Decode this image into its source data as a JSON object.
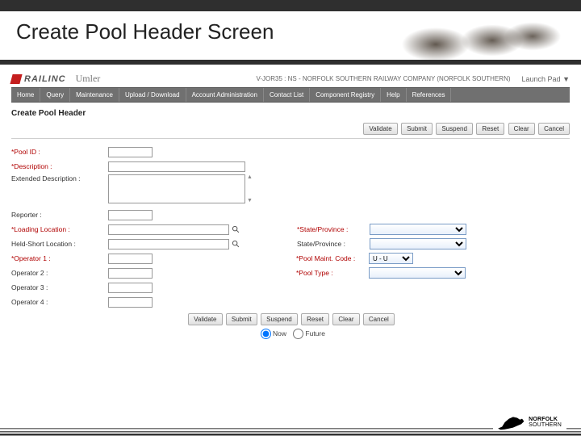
{
  "slide": {
    "title": "Create Pool Header Screen"
  },
  "brand": {
    "name": "RAILINC",
    "product": "Umler"
  },
  "header": {
    "user_context": "V-JOR35 : NS - NORFOLK SOUTHERN RAILWAY COMPANY (NORFOLK SOUTHERN)",
    "launch_pad": "Launch Pad",
    "caret": "▼"
  },
  "nav": [
    "Home",
    "Query",
    "Maintenance",
    "Upload / Download",
    "Account Administration",
    "Contact List",
    "Component Registry",
    "Help",
    "References"
  ],
  "page": {
    "title": "Create Pool Header"
  },
  "buttons": {
    "validate": "Validate",
    "submit": "Submit",
    "suspend": "Suspend",
    "reset": "Reset",
    "clear": "Clear",
    "cancel": "Cancel"
  },
  "labels": {
    "pool_id": "*Pool ID :",
    "description": "*Description :",
    "ext_desc": "Extended Description :",
    "reporter": "Reporter :",
    "loading_loc": "*Loading Location :",
    "held_short": "Held-Short Location :",
    "op1": "*Operator 1 :",
    "op2": "Operator 2 :",
    "op3": "Operator 3 :",
    "op4": "Operator 4 :",
    "state_req": "*State/Province :",
    "state": "State/Province :",
    "pool_maint": "*Pool Maint. Code :",
    "pool_type": "*Pool Type :"
  },
  "values": {
    "pool_maint_selected": "U - U"
  },
  "radio": {
    "now": "Now",
    "future": "Future"
  },
  "footer": {
    "company_top": "NORFOLK",
    "company_bottom": "SOUTHERN"
  }
}
